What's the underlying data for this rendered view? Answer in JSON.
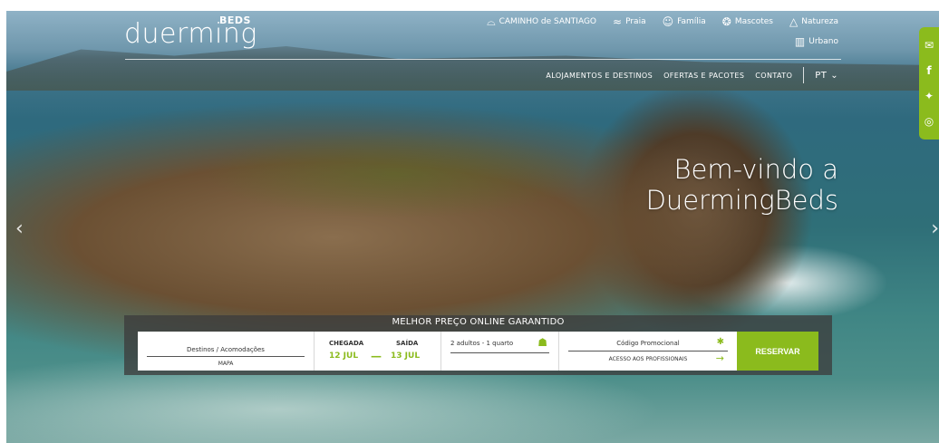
{
  "brand": {
    "logo_text": "duerming",
    "logo_sup": "BEDS"
  },
  "categories": [
    {
      "label": "CAMINHO de SANTIAGO",
      "icon": "shell-icon"
    },
    {
      "label": "Praia",
      "icon": "waves-icon"
    },
    {
      "label": "Família",
      "icon": "family-icon"
    },
    {
      "label": "Mascotes",
      "icon": "pet-icon"
    },
    {
      "label": "Natureza",
      "icon": "mountain-icon"
    }
  ],
  "category_urbano": {
    "label": "Urbano",
    "icon": "building-icon"
  },
  "nav": {
    "items": [
      "ALOJAMENTOS E DESTINOS",
      "OFERTAS E PACOTES",
      "CONTATO"
    ],
    "lang": "PT"
  },
  "hero": {
    "line1": "Bem-vindo a",
    "line2": "DuermingBeds"
  },
  "booking": {
    "title": "MELHOR PREÇO ONLINE GARANTIDO",
    "destination_placeholder": "Destinos / Acomodações",
    "map_link": "MAPA",
    "checkin_label": "CHEGADA",
    "checkin_value": "12 JUL",
    "checkout_label": "SAÍDA",
    "checkout_value": "13 JUL",
    "guests": "2 adultos - 1 quarto",
    "promo_placeholder": "Código Promocional",
    "pro_access": "ACESSO AOS PROFISSIONAIS",
    "submit": "RESERVAR"
  },
  "social": [
    "email-icon",
    "facebook-icon",
    "twitter-icon",
    "instagram-icon"
  ],
  "colors": {
    "accent": "#8bbb1d",
    "booking_bg": "#3c3c3c"
  }
}
